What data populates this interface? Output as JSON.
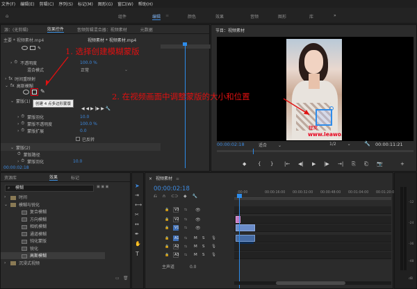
{
  "menu": [
    "文件(F)",
    "编辑(E)",
    "剪辑(C)",
    "序列(S)",
    "标记(M)",
    "图形(G)",
    "窗口(W)",
    "帮助(H)"
  ],
  "workspaces": [
    "组件",
    "编辑",
    "颜色",
    "效果",
    "音频",
    "图形",
    "库"
  ],
  "workspace_more": "»",
  "effect_controls": {
    "tabs": [
      "源：(无剪辑)",
      "效果控件",
      "音频剪辑混合器：视频素材",
      "元数据"
    ],
    "clip_path": "主要 * 视频素材.mp4",
    "sequence_path": "视频素材 * 视频素材.mp4",
    "rows": {
      "opacity": "不透明度",
      "opacity_val": "100.0 %",
      "blend": "混合模式",
      "blend_val": "正常",
      "time_remap": "时间重映射",
      "gaussian": "高斯模糊",
      "mask1": "蒙版(1)",
      "tooltip": "创建 4 点多边形蒙版",
      "mask_feather": "蒙版羽化",
      "mask_feather_val": "10.0",
      "mask_opacity": "蒙版不透明度",
      "mask_opacity_val": "100.0 %",
      "mask_expand": "蒙版扩展",
      "mask_expand_val": "0.0",
      "inverted": "已反转",
      "mask2": "蒙版(2)",
      "mask_path": "蒙版路径",
      "mask_feather2": "蒙版羽化",
      "mask_feather2_val": "10.0"
    },
    "timecode": "00:00:02:18"
  },
  "program": {
    "title": "节目：视频素材",
    "timecode": "00:00:02:18",
    "fit": "适合",
    "quality": "1/2",
    "duration": "00:00:11:21",
    "watermark": "狸窝",
    "watermark2": "www.leawo.cn",
    "controls": [
      "◆",
      "{",
      "}",
      "|←",
      "◀|",
      "▶",
      "|▶",
      "→|",
      "⎘",
      "⎗",
      "📷",
      "+"
    ]
  },
  "project": {
    "tabs": [
      "资源库",
      "效果",
      "标记"
    ],
    "search": "模糊",
    "items": [
      {
        "label": "时间",
        "level": 1,
        "folder": true
      },
      {
        "label": "模糊与锐化",
        "level": 1,
        "folder": true,
        "open": true
      },
      {
        "label": "复合模糊",
        "level": 2
      },
      {
        "label": "方向模糊",
        "level": 2
      },
      {
        "label": "相机模糊",
        "level": 2
      },
      {
        "label": "通道模糊",
        "level": 2
      },
      {
        "label": "钝化蒙版",
        "level": 2
      },
      {
        "label": "锐化",
        "level": 2
      },
      {
        "label": "高斯模糊",
        "level": 2,
        "sel": true
      },
      {
        "label": "沉浸式视频",
        "level": 1,
        "folder": true
      }
    ]
  },
  "timeline": {
    "title": "视频素材",
    "timecode": "00:00:02:18",
    "ruler": [
      ":00:00",
      "00:00:16:00",
      "00:00:32:00",
      "00:00:48:00",
      "00:01:04:00",
      "00:01:20:00"
    ],
    "tracks": [
      "V3",
      "V2",
      "V1",
      "A1",
      "A2",
      "A3"
    ],
    "master": "主声道",
    "master_val": "0.0"
  },
  "meter": [
    "-12",
    "-24",
    "-36",
    "-48",
    "dB"
  ],
  "annotations": {
    "step1": "1. 选择创建模糊蒙版",
    "step2": "2. 在视频画面中调整蒙版的大小和位置"
  },
  "colors": {
    "accent": "#3d8ae0",
    "annotation": "#e01010",
    "playhead": "#2d8ceb",
    "clip_v": "#c47ac0",
    "clip_a": "#6d8fc4"
  }
}
